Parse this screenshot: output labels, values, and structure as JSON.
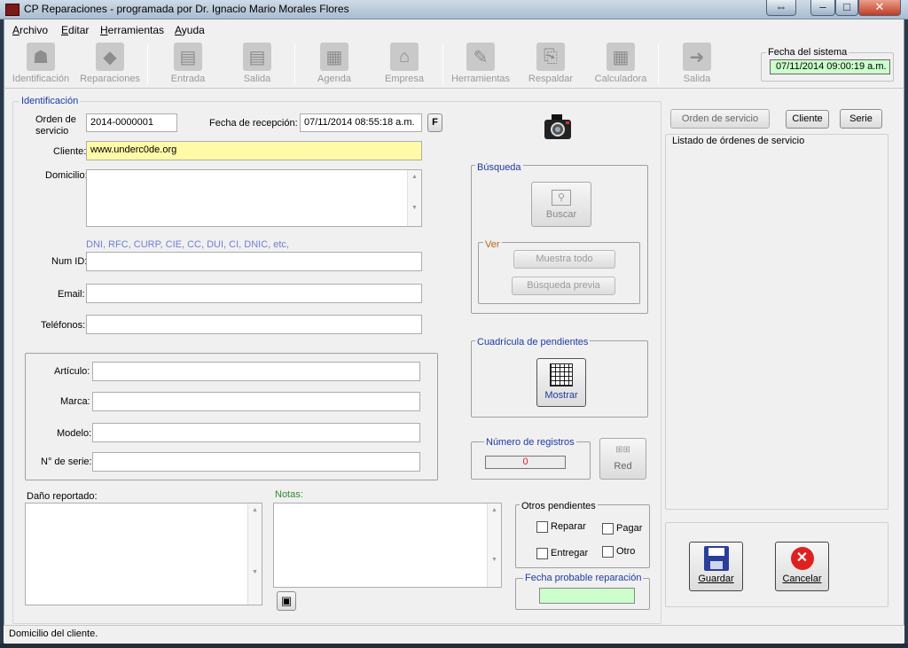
{
  "window": {
    "title": "CP Reparaciones - programada por Dr. Ignacio Mario Morales Flores",
    "caption_restore_extra": "⇔",
    "caption_min": "–",
    "caption_max": "□",
    "caption_close": "✕"
  },
  "menu": [
    {
      "label": "Archivo",
      "accel": "A",
      "rest": "rchivo"
    },
    {
      "label": "Editar",
      "accel": "E",
      "rest": "ditar"
    },
    {
      "label": "Herramientas",
      "accel": "H",
      "rest": "erramientas"
    },
    {
      "label": "Ayuda",
      "accel": "A",
      "rest": "yuda"
    }
  ],
  "toolbar": [
    {
      "label": "Identificación",
      "icon": "user-icon"
    },
    {
      "label": "Reparaciones",
      "icon": "box-icon"
    },
    {
      "label": "Entrada",
      "icon": "clipboard-in-icon"
    },
    {
      "label": "Salida",
      "icon": "clipboard-out-icon"
    },
    {
      "label": "Agenda",
      "icon": "calendar-icon"
    },
    {
      "label": "Empresa",
      "icon": "building-icon"
    },
    {
      "label": "Herramientas",
      "icon": "tools-icon"
    },
    {
      "label": "Respaldar",
      "icon": "backup-icon"
    },
    {
      "label": "Calculadora",
      "icon": "calculator-icon"
    },
    {
      "label": "Salida",
      "icon": "exit-icon"
    }
  ],
  "system_date": {
    "label": "Fecha del sistema",
    "value": "07/11/2014 09:00:19 a.m."
  },
  "identificacion": {
    "group_title": "Identificación",
    "orden_label": "Orden de servicio",
    "orden_value": "2014-0000001",
    "fecha_label": "Fecha de recepción:",
    "fecha_value": "07/11/2014 08:55:18 a.m.",
    "fecha_btn": "F",
    "cliente_label": "Cliente:",
    "cliente_value": "www.underc0de.org",
    "domicilio_label": "Domicilio:",
    "id_hint": "DNI, RFC, CURP, CIE, CC, DUI, CI, DNIC, etc,",
    "numid_label": "Num ID:",
    "email_label": "Email:",
    "telefonos_label": "Teléfonos:"
  },
  "articulo": {
    "articulo_label": "Artículo:",
    "marca_label": "Marca:",
    "modelo_label": "Modelo:",
    "serie_label": "N° de serie:"
  },
  "dano_label": "Daño reportado:",
  "notas_label": "Notas:",
  "busqueda": {
    "group_title": "Búsqueda",
    "buscar_label": "Buscar",
    "ver_title": "Ver",
    "muestra_todo": "Muestra todo",
    "busqueda_previa": "Búsqueda previa"
  },
  "cuadricula": {
    "group_title": "Cuadrícula de pendientes",
    "mostrar_label": "Mostrar"
  },
  "registros": {
    "group_title": "Número de registros",
    "value": "0",
    "red_label": "Red"
  },
  "otros": {
    "group_title": "Otros pendientes",
    "reparar": "Reparar",
    "pagar": "Pagar",
    "entregar": "Entregar",
    "otro": "Otro"
  },
  "fecha_probable": {
    "group_title": "Fecha probable reparación",
    "value": ""
  },
  "listado": {
    "tab_orden": "Orden de servicio",
    "tab_cliente": "Cliente",
    "tab_serie": "Serie",
    "title": "Listado de órdenes de servicio"
  },
  "actions": {
    "guardar": "Guardar",
    "cancelar": "Cancelar"
  },
  "status": "Domicilio del cliente.",
  "colors": {
    "client_highlight": "#fffaa8",
    "date_field_bg": "#ccffcc",
    "link_blue": "#1d3aa0",
    "hint_blue": "#6f7fd6"
  }
}
